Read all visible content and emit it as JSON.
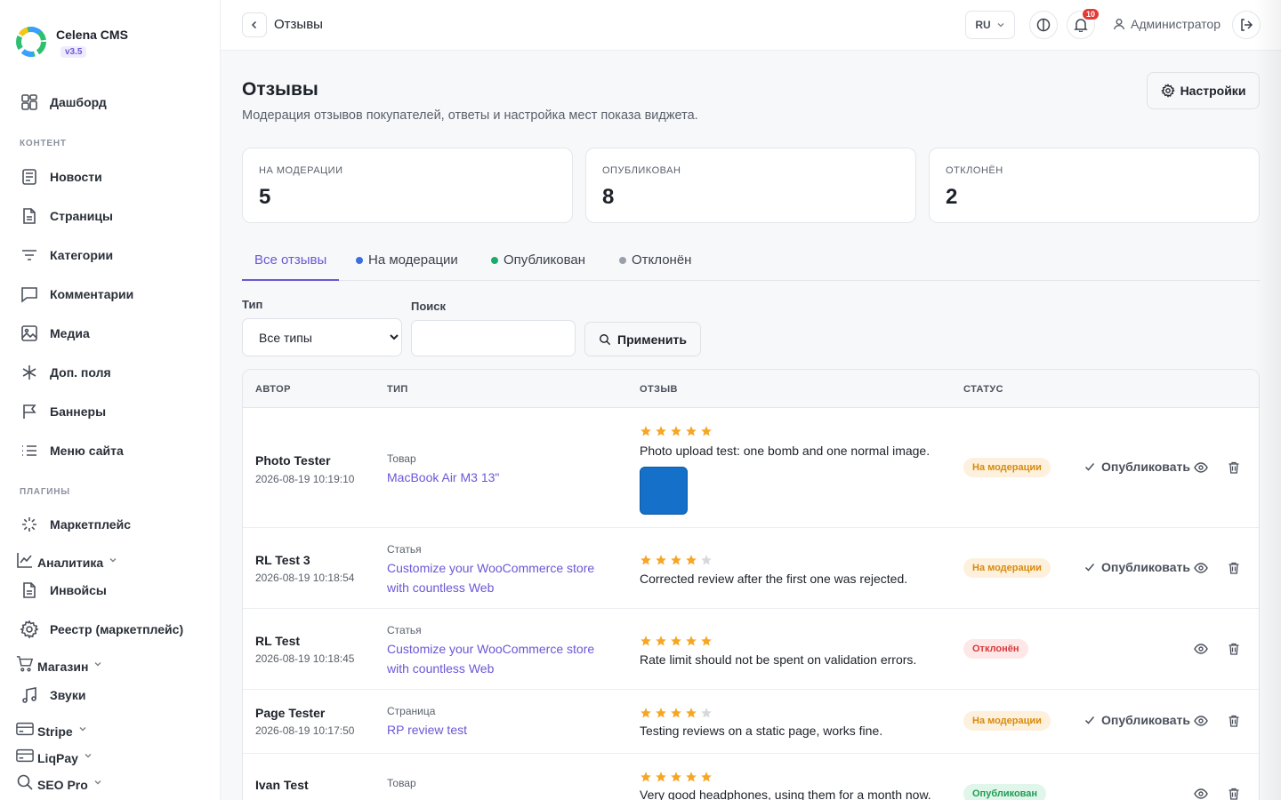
{
  "brand": {
    "name": "Celena CMS",
    "version": "v3.5"
  },
  "sidebar": {
    "top_items": [
      {
        "label": "Дашборд",
        "icon": "dashboard-icon"
      }
    ],
    "section_content": "КОНТЕНТ",
    "content_items": [
      {
        "label": "Новости",
        "icon": "news-icon"
      },
      {
        "label": "Страницы",
        "icon": "page-icon"
      },
      {
        "label": "Категории",
        "icon": "filter-icon"
      },
      {
        "label": "Комментарии",
        "icon": "comment-icon"
      },
      {
        "label": "Медиа",
        "icon": "image-icon"
      },
      {
        "label": "Доп. поля",
        "icon": "asterisk-icon"
      },
      {
        "label": "Баннеры",
        "icon": "flag-icon"
      },
      {
        "label": "Меню сайта",
        "icon": "list-icon"
      }
    ],
    "section_plugins": "ПЛАГИНЫ",
    "plugin_items": [
      {
        "label": "Маркетплейс",
        "icon": "loader-icon"
      },
      {
        "label": "Аналитика",
        "icon": "chart-line-icon"
      },
      {
        "label": "Инвойсы",
        "icon": "invoice-icon"
      },
      {
        "label": "Реестр (маркетплейс)",
        "icon": "gear-icon"
      },
      {
        "label": "Магазин",
        "icon": "cart-icon"
      },
      {
        "label": "Звуки",
        "icon": "music-icon"
      },
      {
        "label": "Stripe",
        "icon": "card-icon"
      },
      {
        "label": "LiqPay",
        "icon": "card-icon"
      },
      {
        "label": "SEO Pro",
        "icon": "search-icon"
      }
    ]
  },
  "topbar": {
    "title": "Отзывы",
    "lang": "RU",
    "notifications": "10",
    "user": "Администратор"
  },
  "page": {
    "title": "Отзывы",
    "subtitle": "Модерация отзывов покупателей, ответы и настройка мест показа виджета.",
    "settings_label": "Настройки"
  },
  "stats": [
    {
      "label": "НА МОДЕРАЦИИ",
      "value": "5"
    },
    {
      "label": "ОПУБЛИКОВАН",
      "value": "8"
    },
    {
      "label": "ОТКЛОНЁН",
      "value": "2"
    }
  ],
  "tabs": [
    {
      "label": "Все отзывы"
    },
    {
      "label": "На модерации",
      "dot": "#3b6fe0"
    },
    {
      "label": "Опубликован",
      "dot": "#1faa6b"
    },
    {
      "label": "Отклонён",
      "dot": "#9aa0aa"
    }
  ],
  "filters": {
    "type_label": "Тип",
    "type_selected": "Все типы",
    "search_label": "Поиск",
    "search_value": "",
    "apply_label": "Применить"
  },
  "table": {
    "headers": {
      "author": "АВТОР",
      "type": "ТИП",
      "review": "ОТЗЫВ",
      "status": "СТАТУС"
    },
    "publish_label": "Опубликовать",
    "rows": [
      {
        "author": "Photo Tester",
        "date": "2026-08-19 10:19:10",
        "type": "Товар",
        "item": "MacBook Air M3 13\"",
        "rating": 5,
        "text": "Photo upload test: one bomb and one normal image.",
        "status": "На модерации"
      },
      {
        "author": "RL Test 3",
        "date": "2026-08-19 10:18:54",
        "type": "Статья",
        "item": "Customize your WooCommerce store with countless Web",
        "rating": 4,
        "text": "Corrected review after the first one was rejected.",
        "status": "На модерации"
      },
      {
        "author": "RL Test",
        "date": "2026-08-19 10:18:45",
        "type": "Статья",
        "item": "Customize your WooCommerce store with countless Web",
        "rating": 5,
        "text": "Rate limit should not be spent on validation errors.",
        "status": "Отклонён"
      },
      {
        "author": "Page Tester",
        "date": "2026-08-19 10:17:50",
        "type": "Страница",
        "item": "RP review test",
        "rating": 4,
        "text": "Testing reviews on a static page, works fine.",
        "status": "На модерации"
      },
      {
        "author": "Ivan Test",
        "date": "",
        "type": "Товар",
        "item": "",
        "rating": 5,
        "text": "Very good headphones, using them for a month now.",
        "status": "Опубликован"
      }
    ]
  },
  "colors": {
    "accent": "#6b57d6",
    "star": "#f5a623",
    "star_empty": "#d5d8dd"
  }
}
